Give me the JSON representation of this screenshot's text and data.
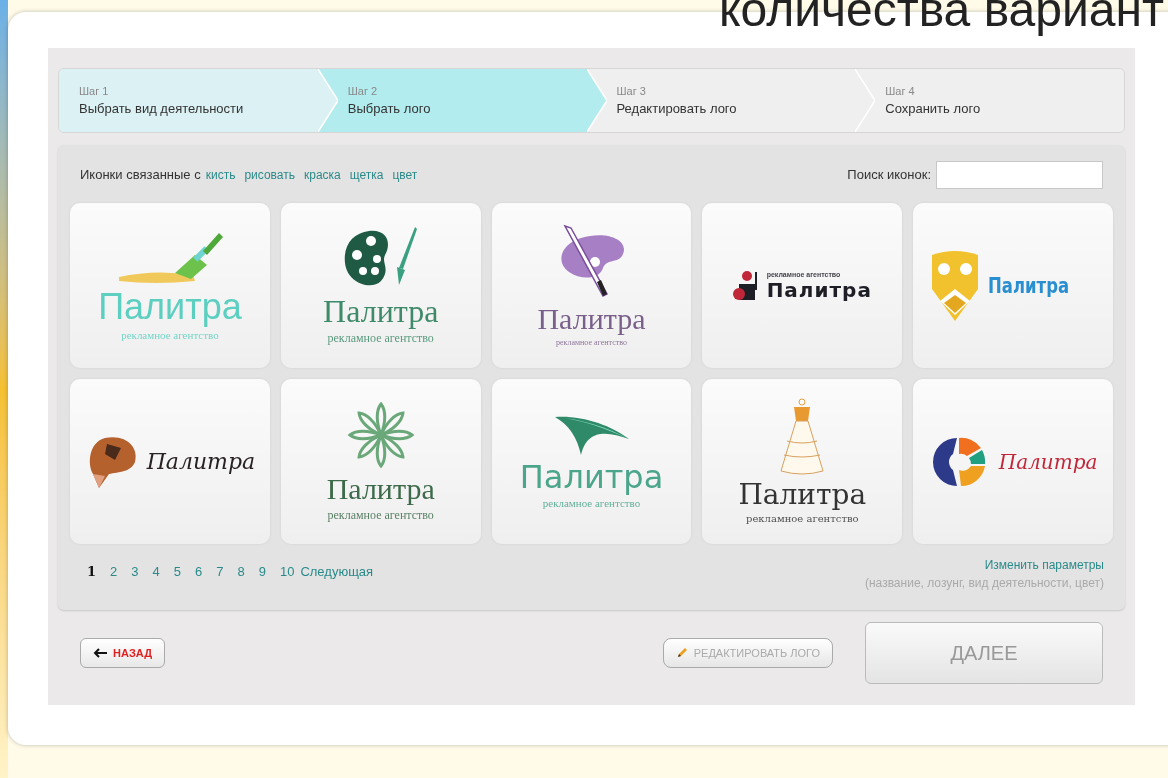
{
  "slide_heading": "количества вариант",
  "steps": [
    {
      "step": "Шаг 1",
      "label": "Выбрать вид деятельности",
      "selected": false
    },
    {
      "step": "Шаг 2",
      "label": "Выбрать лого",
      "selected": true
    },
    {
      "step": "Шаг 3",
      "label": "Редактировать лого",
      "selected": false
    },
    {
      "step": "Шаг 4",
      "label": "Сохранить лого",
      "selected": false
    }
  ],
  "related": {
    "label": "Иконки связанные с",
    "tags": [
      "кисть",
      "рисовать",
      "краска",
      "щетка",
      "цвет"
    ]
  },
  "search": {
    "label": "Поиск иконок:"
  },
  "logos": [
    {
      "kind": "brush",
      "name": "Палитра",
      "tagline": "рекламное агентство",
      "color": "#5ccfc0"
    },
    {
      "kind": "palette",
      "name": "Палитра",
      "tagline": "рекламное агентство",
      "color": "#3f8a6a"
    },
    {
      "kind": "palette-brush",
      "name": "Палитра",
      "tagline": "рекламное агентство",
      "color": "#7a5f8a"
    },
    {
      "kind": "figure",
      "name": "Палитра",
      "tagline": "рекламное агентство",
      "color": "#1e1e26"
    },
    {
      "kind": "shield",
      "name": "Палитра",
      "color": "#2a8fd0"
    },
    {
      "kind": "head",
      "name": "Палитра",
      "color": "#2a2222"
    },
    {
      "kind": "flower",
      "name": "Палитра",
      "tagline": "рекламное агентство",
      "color": "#3d6a4a"
    },
    {
      "kind": "swoosh",
      "name": "Палитра",
      "tagline": "рекламное агентство",
      "color": "#4aa58a"
    },
    {
      "kind": "dress",
      "name": "Палитра",
      "tagline": "рекламное агентство",
      "color": "#333333"
    },
    {
      "kind": "ring",
      "name": "Палитра",
      "color": "#c0283a"
    }
  ],
  "pagination": {
    "pages": [
      {
        "label": "1",
        "selected": true
      },
      {
        "label": "2",
        "selected": false
      },
      {
        "label": "3",
        "selected": false
      },
      {
        "label": "4",
        "selected": false
      },
      {
        "label": "5",
        "selected": false
      },
      {
        "label": "6",
        "selected": false
      },
      {
        "label": "7",
        "selected": false
      },
      {
        "label": "8",
        "selected": false
      },
      {
        "label": "9",
        "selected": false
      },
      {
        "label": "10",
        "selected": false
      }
    ],
    "next": "Следующая"
  },
  "change_params": {
    "link": "Изменить параметры",
    "hint": "(название, лозунг, вид деятельности, цвет)"
  },
  "buttons": {
    "back": {
      "label": "НАЗАД",
      "disabled": false
    },
    "edit": {
      "label": "РЕДАКТИРОВАТЬ ЛОГО",
      "disabled": true
    },
    "next": {
      "label": "ДАЛЕЕ",
      "disabled": true
    }
  }
}
